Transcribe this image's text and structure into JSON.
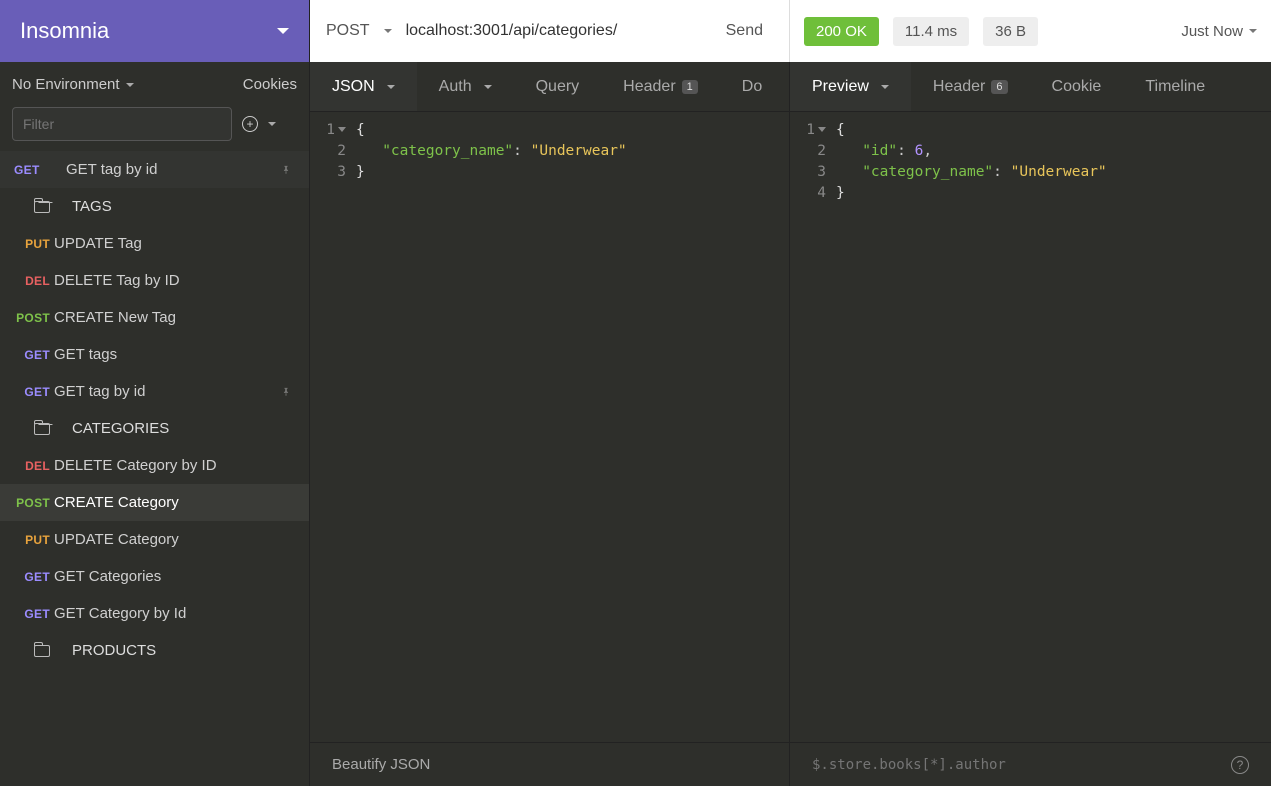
{
  "app": {
    "title": "Insomnia"
  },
  "sidebar": {
    "environment_label": "No Environment",
    "cookies_label": "Cookies",
    "filter_placeholder": "Filter",
    "top_request": {
      "method": "GET",
      "label": "GET tag by id"
    },
    "folders": [
      {
        "name": "TAGS",
        "open": true,
        "items": [
          {
            "method": "PUT",
            "label": "UPDATE Tag"
          },
          {
            "method": "DEL",
            "label": "DELETE Tag by ID"
          },
          {
            "method": "POST",
            "label": "CREATE New Tag"
          },
          {
            "method": "GET",
            "label": "GET tags"
          },
          {
            "method": "GET",
            "label": "GET tag by id",
            "pinned": true
          }
        ]
      },
      {
        "name": "CATEGORIES",
        "open": true,
        "items": [
          {
            "method": "DEL",
            "label": "DELETE Category by ID"
          },
          {
            "method": "POST",
            "label": "CREATE Category",
            "selected": true
          },
          {
            "method": "PUT",
            "label": "UPDATE Category"
          },
          {
            "method": "GET",
            "label": "GET Categories"
          },
          {
            "method": "GET",
            "label": "GET Category by Id"
          }
        ]
      },
      {
        "name": "PRODUCTS",
        "open": false,
        "items": []
      }
    ]
  },
  "request": {
    "method": "POST",
    "url": "localhost:3001/api/categories/",
    "send_label": "Send",
    "tabs": {
      "body_type": "JSON",
      "auth": "Auth",
      "query": "Query",
      "header": "Header",
      "header_count": "1",
      "docs": "Do"
    },
    "body_json": {
      "category_name": "Underwear"
    },
    "beautify_label": "Beautify JSON"
  },
  "response": {
    "status_code": "200 OK",
    "time": "11.4 ms",
    "size": "36 B",
    "when": "Just Now",
    "tabs": {
      "preview": "Preview",
      "header": "Header",
      "header_count": "6",
      "cookie": "Cookie",
      "timeline": "Timeline"
    },
    "body_json": {
      "id": 6,
      "category_name": "Underwear"
    },
    "jsonpath_placeholder": "$.store.books[*].author"
  },
  "colors": {
    "accent": "#695eb8",
    "ok": "#6fbf3a",
    "get": "#9b8cff",
    "put": "#e8a33d",
    "del": "#e86161",
    "post": "#7ec24a"
  }
}
